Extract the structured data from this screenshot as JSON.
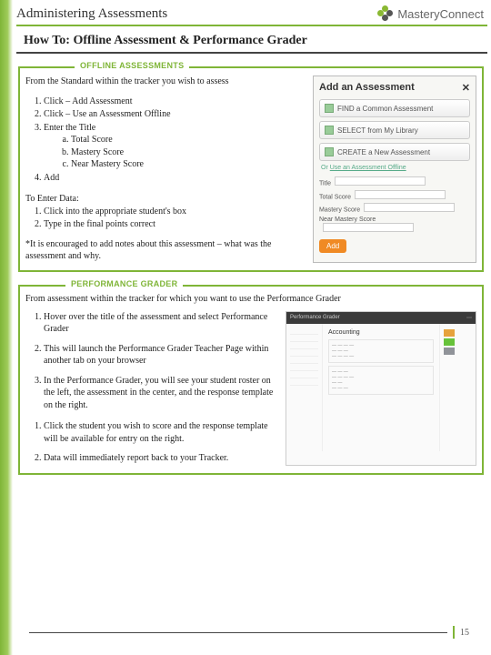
{
  "header": {
    "title": "Administering Assessments",
    "brand": "MasteryConnect"
  },
  "howto": {
    "prefix": "How To:",
    "title": "Offline Assessment & Performance Grader"
  },
  "offline": {
    "label": "OFFLINE ASSESSMENTS",
    "intro": "From the Standard within the tracker you wish to assess",
    "steps": {
      "s1": "Click – Add Assessment",
      "s2": "Click – Use an Assessment Offline",
      "s3": "Enter the Title",
      "s3a": "Total Score",
      "s3b": "Mastery Score",
      "s3c": "Near Mastery Score",
      "s4": "Add"
    },
    "enter_title": "To Enter Data:",
    "enter1": "Click into the appropriate student's box",
    "enter2": "Type in the final points correct",
    "note": "*It is encouraged to add notes about this assessment – what was the assessment and why."
  },
  "dialog": {
    "title": "Add an Assessment",
    "find": "FIND a Common Assessment",
    "select": "SELECT from My Library",
    "create": "CREATE a New Assessment",
    "or": "Or  ",
    "link": "Use an Assessment Offline",
    "f_title": "Title",
    "f_total": "Total Score",
    "f_mastery": "Mastery Score",
    "f_near": "Near Mastery Score",
    "add": "Add"
  },
  "perf": {
    "label": "PERFORMANCE GRADER",
    "intro": "From assessment within the tracker for which you want to use the Performance Grader",
    "a1": "Hover over the title of the assessment and select Performance Grader",
    "a2": "This will launch the Performance Grader Teacher Page within another tab on your browser",
    "a3": "In the Performance Grader, you will see your student roster on the left, the assessment in the center, and the response template on the right.",
    "b1": "Click the student you wish to score and the response template will be available for entry on the right.",
    "b2": "Data will immediately report back to your Tracker."
  },
  "pg_preview": {
    "topbar": "Performance Grader",
    "heading": "Accounting"
  },
  "page_number": "15"
}
